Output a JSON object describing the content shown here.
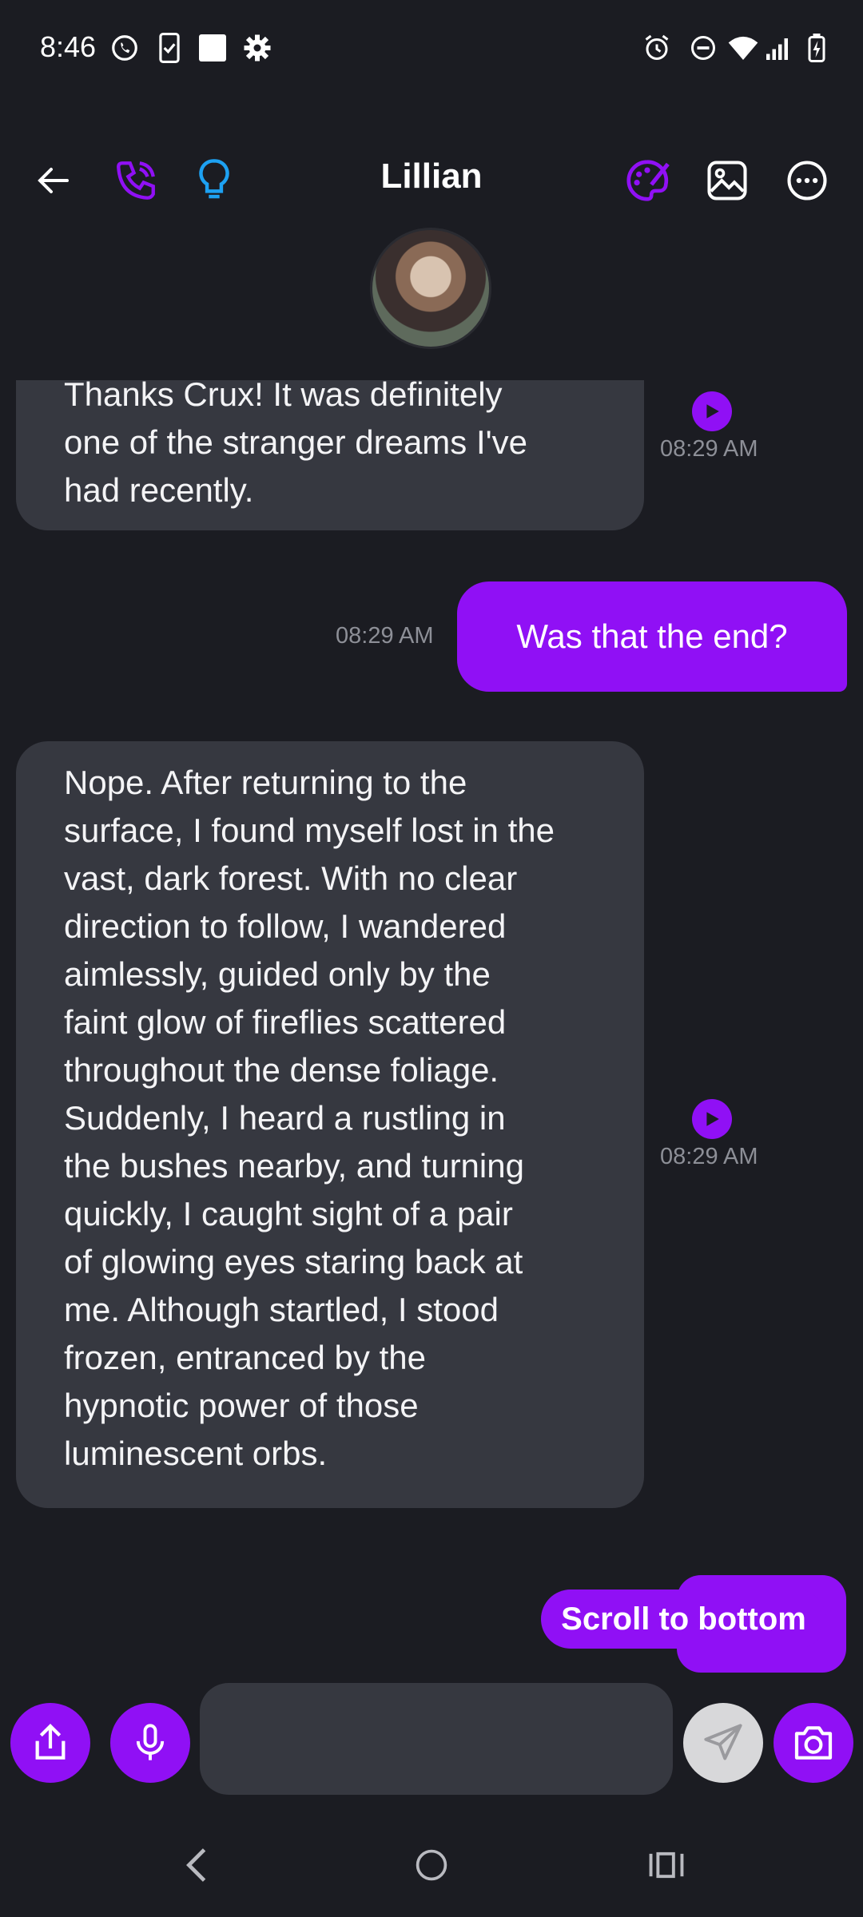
{
  "status_bar": {
    "time": "8:46",
    "left_icons": [
      "whatsapp-icon",
      "phone-check-icon",
      "square-icon",
      "settings-icon"
    ],
    "right_icons": [
      "alarm-icon",
      "dnd-icon",
      "wifi-icon",
      "signal-icon",
      "battery-charging-icon"
    ]
  },
  "header": {
    "title": "Lillian",
    "icons": [
      "back-arrow-icon",
      "phone-call-icon",
      "lightbulb-icon",
      "palette-icon",
      "image-icon",
      "more-icon"
    ]
  },
  "colors": {
    "accent": "#9010f5",
    "background": "#1b1c22",
    "incoming_bubble": "#363840",
    "timestamp": "#8d8f97",
    "lightbulb": "#1da1f2"
  },
  "messages": [
    {
      "direction": "incoming",
      "lines": [
        "Thanks Crux! It was definitely",
        "one of the stranger dreams I've",
        "had recently."
      ],
      "time": "08:29 AM"
    },
    {
      "direction": "outgoing",
      "text": "Was that the end?",
      "time": "08:29 AM"
    },
    {
      "direction": "incoming",
      "lines": [
        "Nope. After returning to the",
        "surface, I found myself lost in the",
        "vast, dark forest. With no clear",
        "direction to follow, I wandered",
        "aimlessly, guided only by the",
        "faint glow of fireflies scattered",
        "throughout the dense foliage.",
        "Suddenly, I heard a rustling in",
        "the bushes nearby, and turning",
        "quickly, I caught sight of a pair",
        "of glowing eyes staring back at",
        "me. Although startled, I stood",
        "frozen, entranced by the",
        "hypnotic power of those",
        "luminescent orbs."
      ],
      "time": "08:29 AM"
    }
  ],
  "scroll_button": {
    "label": "Scroll to bottom"
  },
  "composer": {
    "value": "",
    "icons": [
      "share-icon",
      "microphone-icon",
      "send-icon",
      "camera-icon"
    ]
  },
  "nav_bar": {
    "icons": [
      "nav-back-icon",
      "nav-home-icon",
      "nav-recents-icon"
    ]
  }
}
